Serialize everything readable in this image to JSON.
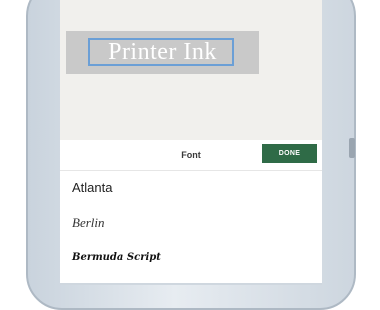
{
  "preview": {
    "text": "Printer Ink"
  },
  "sheet": {
    "title": "Font",
    "done_label": "DONE"
  },
  "fonts": [
    {
      "label": "Atlanta"
    },
    {
      "label": "Berlin"
    },
    {
      "label": "Bermuda Script"
    }
  ],
  "colors": {
    "done_button": "#2f6b47",
    "selection_border": "#6b9fd6",
    "canvas_bg": "#f1f0ed"
  }
}
